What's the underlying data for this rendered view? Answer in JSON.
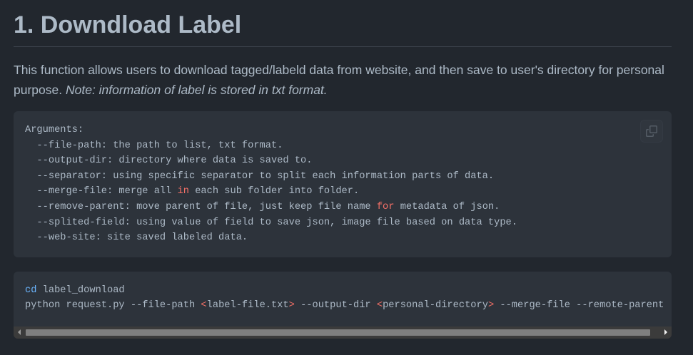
{
  "section": {
    "heading": "1. Downdload Label",
    "description": {
      "text": "This function allows users to download tagged/labeld data from website, and then save to user's directory for personal purpose.",
      "note": "Note: information of label is stored in txt format."
    }
  },
  "code_blocks": [
    {
      "copy_button": {
        "icon": "copy-icon"
      },
      "lines": [
        [
          {
            "text": "Arguments:"
          }
        ],
        [
          {
            "text": "  --file-path: the path to list, txt format."
          }
        ],
        [
          {
            "text": "  --output-dir: directory where data is saved to."
          }
        ],
        [
          {
            "text": "  --separator: using specific separator to split each information parts of data."
          }
        ],
        [
          {
            "text": "  --merge-file: merge all "
          },
          {
            "text": "in",
            "color": "#f47067"
          },
          {
            "text": " each sub folder into folder."
          }
        ],
        [
          {
            "text": "  --remove-parent: move parent of file, just keep file name "
          },
          {
            "text": "for",
            "color": "#f47067"
          },
          {
            "text": " metadata of json."
          }
        ],
        [
          {
            "text": "  --splited-field: using value of field to save json, image file based on data type."
          }
        ],
        [
          {
            "text": "  --web-site: site saved labeled data."
          }
        ]
      ]
    },
    {
      "lines": [
        [
          {
            "text": "cd",
            "color": "#6cb6ff"
          },
          {
            "text": " label_download"
          }
        ],
        [
          {
            "text": "python request.py --file-path "
          },
          {
            "text": "<",
            "color": "#f47067"
          },
          {
            "text": "label-file.txt"
          },
          {
            "text": ">",
            "color": "#f47067"
          },
          {
            "text": " --output-dir "
          },
          {
            "text": "<",
            "color": "#f47067"
          },
          {
            "text": "personal-directory"
          },
          {
            "text": ">",
            "color": "#f47067"
          },
          {
            "text": " --merge-file --remote-parent"
          }
        ]
      ],
      "scrollbar": {
        "visible_fraction": 0.985,
        "scroll_position": 0
      }
    }
  ]
}
